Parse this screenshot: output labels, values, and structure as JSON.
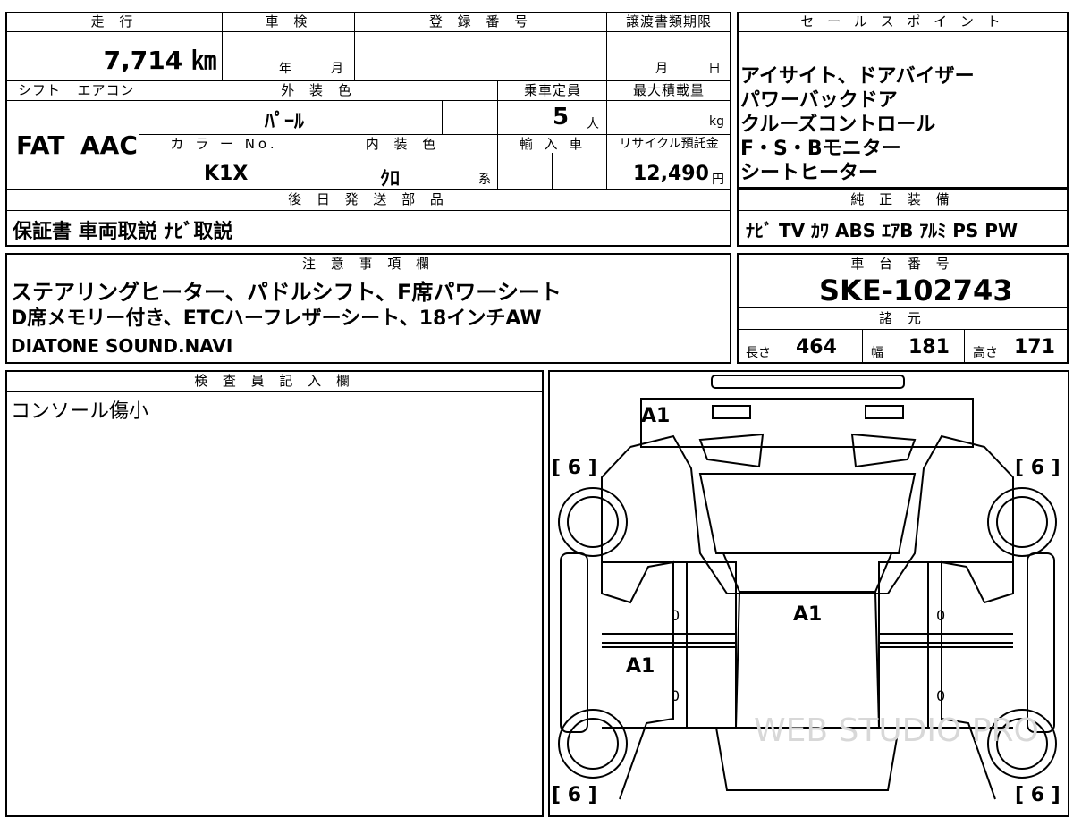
{
  "top_table": {
    "headers": {
      "mileage": "走 行",
      "inspection": "車 検",
      "registration_no": "登 録 番 号",
      "transfer_deadline": "譲渡書類期限",
      "shift": "シフト",
      "aircon": "エアコン",
      "exterior_color": "外 装 色",
      "capacity": "乗車定員",
      "max_load": "最大積載量",
      "color_no": "カ ラ ー No.",
      "interior_color": "内 装 色",
      "import": "輸 入 車",
      "recycle_fee": "リサイクル預託金",
      "later_parts": "後 日 発 送 部 品"
    },
    "values": {
      "mileage": "7,714 ㎞",
      "inspection_year": "年",
      "inspection_month": "月",
      "transfer_month": "月",
      "transfer_day": "日",
      "shift": "FAT",
      "aircon": "AAC",
      "exterior_color": "ﾊﾟｰﾙ",
      "capacity": "5",
      "capacity_unit": "人",
      "max_load_unit": "kg",
      "color_no": "K1X",
      "interior_color": "ｸﾛ",
      "interior_suffix": "系",
      "recycle_fee": "12,490",
      "recycle_unit": "円",
      "later_parts": "保証書 車両取説 ﾅﾋﾞ取説"
    }
  },
  "sales_points": {
    "header": "セ ー ル ス ポ イ ン ト",
    "lines": [
      "アイサイト、ドアバイザー",
      "パワーバックドア",
      "クルーズコントロール",
      "F・S・Bモニター",
      "シートヒーター"
    ]
  },
  "genuine_equipment": {
    "header": "純 正 装 備",
    "items": "ﾅﾋﾞ TV ｶﾜ ABS ｴｱB ｱﾙﾐ PS PW"
  },
  "notes": {
    "header": "注 意 事 項 欄",
    "lines": [
      "ステアリングヒーター、パドルシフト、F席パワーシート",
      "D席メモリー付き、ETCハーフレザーシート、18インチAW",
      "DIATONE SOUND.NAVI"
    ]
  },
  "chassis": {
    "header": "車 台 番 号",
    "number": "SKE-102743"
  },
  "specs": {
    "header": "諸 元",
    "length_label": "長さ",
    "length": "464",
    "width_label": "幅",
    "width": "181",
    "height_label": "高さ",
    "height": "171"
  },
  "inspector": {
    "header": "検 査 員 記 入 欄",
    "comment": "コンソール傷小"
  },
  "diagram": {
    "marks": {
      "front": "A1",
      "roof": "A1",
      "left_door": "A1",
      "tire_fl": "[ 6 ]",
      "tire_fr": "[ 6 ]",
      "tire_rl": "[ 6 ]",
      "tire_rr": "[ 6 ]",
      "door_fl": "0",
      "door_fr": "0",
      "door_rl": "0",
      "door_rr": "0"
    },
    "watermark": "WEB STUDIO PRO"
  }
}
